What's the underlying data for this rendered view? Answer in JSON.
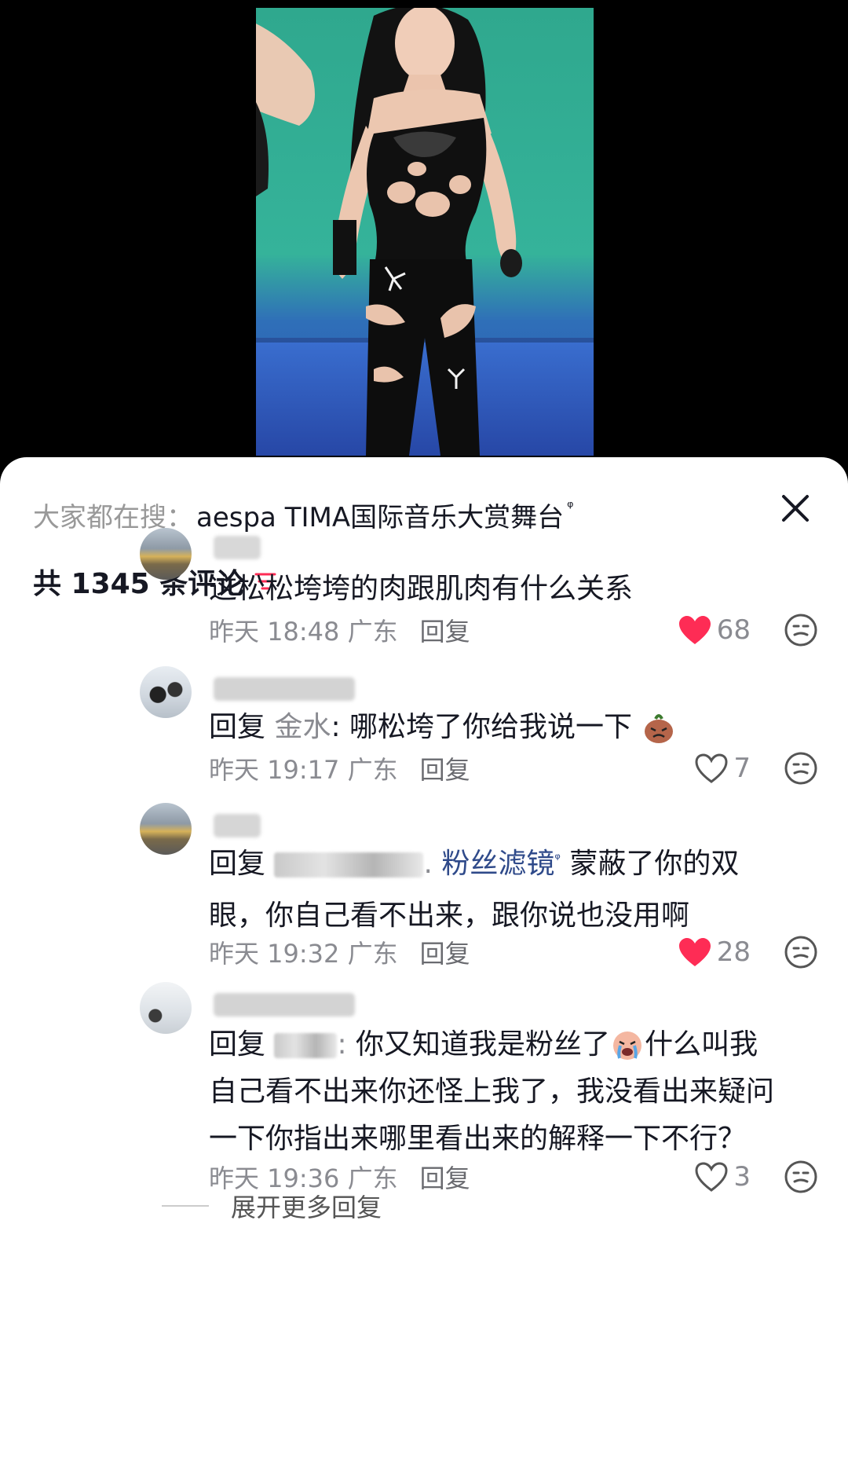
{
  "search": {
    "prefix": "大家都在搜：",
    "term": "aespa TIMA国际音乐大赏舞台",
    "search_glyph": "ᵠ"
  },
  "comments_count_label": "共 1345 条评论",
  "comments": [
    {
      "avatar": "sea-sunset",
      "text": "这松松垮垮的肉跟肌肉有什么关系",
      "time": "昨天 18:48",
      "location": "广东",
      "reply_label": "回复",
      "likes": "68",
      "liked": true
    },
    {
      "avatar": "penguin",
      "reply_prefix": "回复",
      "reply_to": "金水",
      "text": ": 哪松垮了你给我说一下",
      "emoji": "angry-sweet-potato",
      "time": "昨天 19:17",
      "location": "广东",
      "reply_label": "回复",
      "likes": "7",
      "liked": false
    },
    {
      "avatar": "sea-sunset",
      "reply_prefix": "回复",
      "text_line1_link": "粉丝滤镜",
      "text_line1_after": "蒙蔽了你的双",
      "text_line2": "眼，你自己看不出来，跟你说也没用啊",
      "time": "昨天 19:32",
      "location": "广东",
      "reply_label": "回复",
      "likes": "28",
      "liked": true
    },
    {
      "avatar": "snow",
      "reply_prefix": "回复",
      "text_line1": "你又知道我是粉丝了",
      "emoji": "crying-face",
      "text_line1_after": "什么叫我",
      "text_line2": "自己看不出来你还怪上我了，我没看出来疑问",
      "text_line3": "一下你指出来哪里看出来的解释一下不行？",
      "time": "昨天 19:36",
      "location": "广东",
      "reply_label": "回复",
      "likes": "3",
      "liked": false
    }
  ],
  "expand_more_label": "展开更多回复",
  "colors": {
    "like_red": "#fe2c55",
    "meta_gray": "#8a8b91",
    "text": "#161823",
    "link": "#2f4a8a"
  }
}
